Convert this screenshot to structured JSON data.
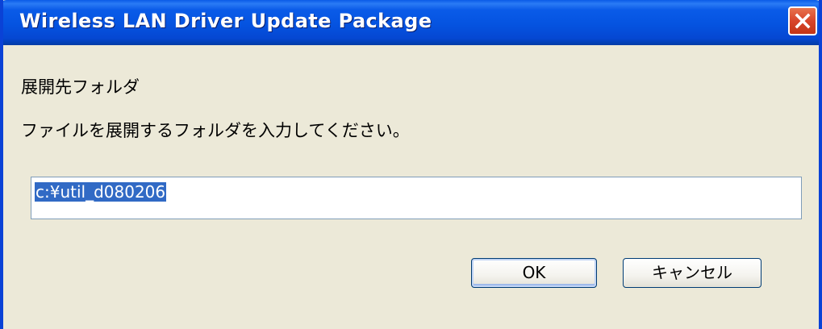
{
  "window": {
    "title": "Wireless LAN Driver Update Package",
    "close_icon": "close-icon"
  },
  "dialog": {
    "heading": "展開先フォルダ",
    "instruction": "ファイルを展開するフォルダを入力してください。",
    "folder_path": {
      "value": "c:¥util_d080206",
      "selected": true
    },
    "buttons": {
      "ok_label": "OK",
      "cancel_label": "キャンセル"
    }
  },
  "colors": {
    "titlebar": "#0553e0",
    "dialog_background": "#ece9d8",
    "selection": "#316ac5",
    "close_button": "#d8452a"
  }
}
